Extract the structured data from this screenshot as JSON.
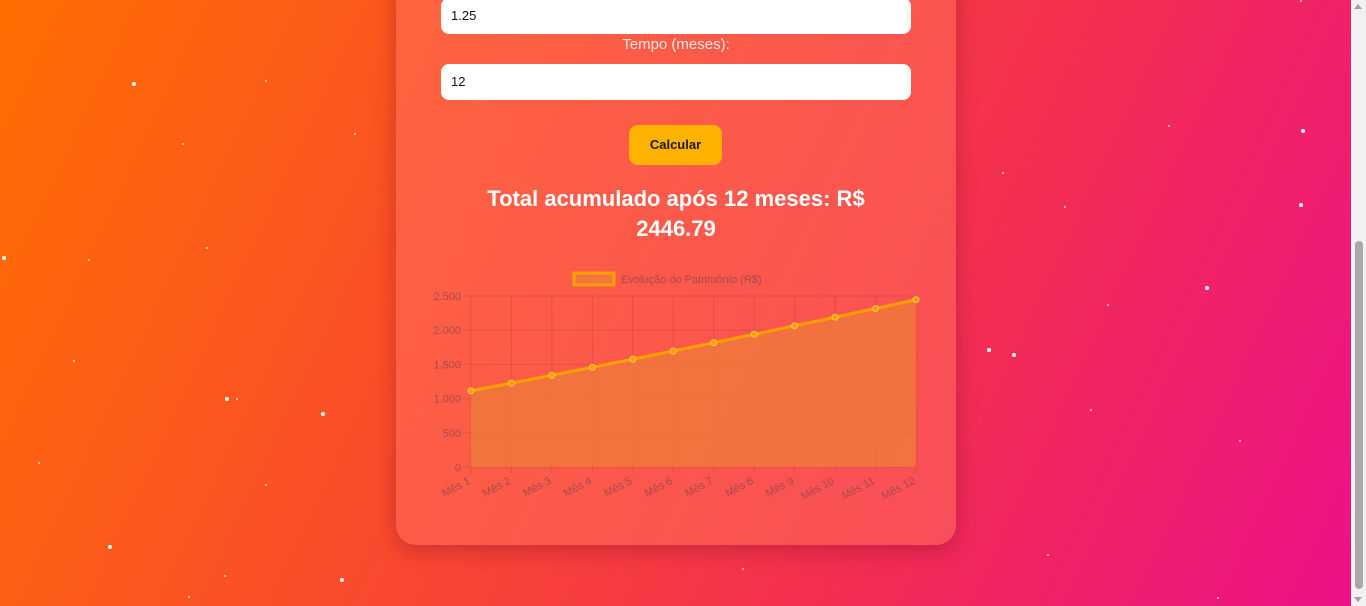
{
  "form": {
    "rate_value": "1.25",
    "time_label": "Tempo (meses):",
    "time_value": "12",
    "calculate_label": "Calcular"
  },
  "result": {
    "text": "Total acumulado após 12 meses: R$ 2446.79"
  },
  "colors": {
    "button": "#ffb300",
    "line": "#ffa000",
    "area": "#f0783c"
  },
  "chart_data": {
    "type": "line",
    "legend": "Evolução do Patrimônio (R$)",
    "legend_position": "top",
    "categories": [
      "Mês 1",
      "Mês 2",
      "Mês 3",
      "Mês 4",
      "Mês 5",
      "Mês 6",
      "Mês 7",
      "Mês 8",
      "Mês 9",
      "Mês 10",
      "Mês 11",
      "Mês 12"
    ],
    "series": [
      {
        "name": "Evolução do Patrimônio (R$)",
        "values": [
          1112.5,
          1226.41,
          1341.74,
          1458.51,
          1576.74,
          1696.45,
          1817.66,
          1940.38,
          2064.63,
          2190.44,
          2317.82,
          2446.79
        ]
      }
    ],
    "y_ticks": [
      "2.500",
      "2.000",
      "1.500",
      "1.000",
      "500",
      "0"
    ],
    "ylim": [
      0,
      2500
    ],
    "grid": true,
    "fill": true
  }
}
